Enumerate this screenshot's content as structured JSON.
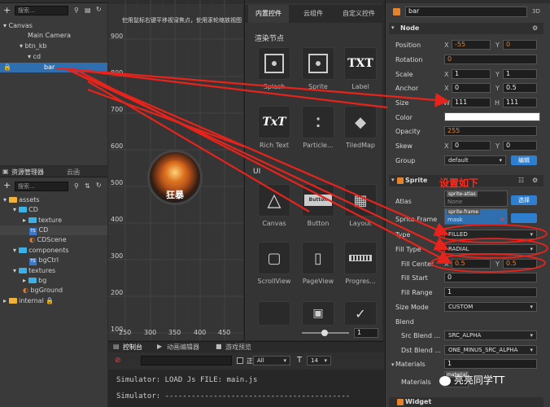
{
  "hierarchy": {
    "search_placeholder": "搜索...",
    "tree": [
      "Canvas",
      "Main Camera",
      "btn_kb",
      "cd",
      "bar"
    ]
  },
  "assets": {
    "tabs": [
      "资源管理器",
      "云函"
    ],
    "search_placeholder": "搜索...",
    "tree": [
      "assets",
      "CD",
      "texture",
      "CD",
      "CDScene",
      "components",
      "bgCtrl",
      "textures",
      "bg",
      "bgGround",
      "internal"
    ]
  },
  "scene": {
    "hint": "使用鼠标右键平移视窗焦点，使用滚轮缩放视图",
    "y_ticks": [
      "900",
      "800",
      "700",
      "600",
      "500",
      "400",
      "300",
      "200",
      "100"
    ],
    "x_ticks": [
      "250",
      "300",
      "350",
      "400",
      "450"
    ],
    "sprite_text": "狂暴",
    "zoom_value": "1"
  },
  "controls": {
    "tabs": [
      "内置控件",
      "云组件",
      "自定义控件"
    ],
    "render_section": "渲染节点",
    "ui_section": "UI",
    "render_items": [
      "Splash",
      "Sprite",
      "Label",
      "Rich Text",
      "Particle...",
      "TiledMap"
    ],
    "ui_items": [
      "Canvas",
      "Button",
      "Layout",
      "ScrollView",
      "PageView",
      "Progres..."
    ],
    "label_glyph": "TXT",
    "richtext_glyph": "TxT",
    "button_glyph": "Button"
  },
  "console": {
    "tabs": [
      "控制台",
      "动画编辑器",
      "游戏预览"
    ],
    "regex_label": "正则",
    "filter_value": "All",
    "font_size": "14",
    "lines": [
      "Simulator: LOAD Js FILE: main.js",
      "Simulator: ------------------------------------------"
    ]
  },
  "inspector": {
    "node_name": "bar",
    "node_badge": "3D",
    "node_section": "Node",
    "labels": {
      "position": "Position",
      "rotation": "Rotation",
      "scale": "Scale",
      "anchor": "Anchor",
      "size": "Size",
      "color": "Color",
      "opacity": "Opacity",
      "skew": "Skew",
      "group": "Group"
    },
    "position": {
      "x": "-55",
      "y": "0"
    },
    "rotation": "0",
    "scale": {
      "x": "1",
      "y": "1"
    },
    "anchor": {
      "x": "0",
      "y": "0.5"
    },
    "size": {
      "w": "111",
      "h": "111"
    },
    "opacity": "255",
    "skew": {
      "x": "0",
      "y": "0"
    },
    "group": "default",
    "edit_button": "编辑",
    "xy": {
      "x": "X",
      "y": "Y",
      "w": "W",
      "h": "H"
    },
    "sprite_section": "Sprite",
    "sprite_labels": {
      "atlas": "Atlas",
      "sprite_frame": "Sprite Frame",
      "type": "Type",
      "fill_type": "Fill Type",
      "fill_center": "Fill Center",
      "fill_start": "Fill Start",
      "fill_range": "Fill Range",
      "size_mode": "Size Mode",
      "blend": "Blend",
      "src_blend": "Src Blend ...",
      "dst_blend": "Dst Blend ..."
    },
    "atlas_tag": "sprite-atlas",
    "atlas_value": "None",
    "frame_tag": "sprite-frame",
    "frame_value": "mask",
    "select_button": "选择",
    "type": "FILLED",
    "fill_type": "RADIAL",
    "fill_center": {
      "x": "0.5",
      "y": "0.5"
    },
    "fill_start": "0",
    "fill_range": "1",
    "size_mode": "CUSTOM",
    "src_blend": "SRC_ALPHA",
    "dst_blend": "ONE_MINUS_SRC_ALPHA",
    "materials_label": "Materials",
    "materials_count": "1",
    "materials_tag": "material",
    "widget_section": "Widget"
  },
  "annotation": {
    "note": "设置如下",
    "watermark": "亮亮同学TT"
  },
  "colors": {
    "arrow": "#e8231b",
    "selection": "#2f6fb0",
    "accent_orange": "#e7822c",
    "blue_button": "#2f7fd0"
  }
}
